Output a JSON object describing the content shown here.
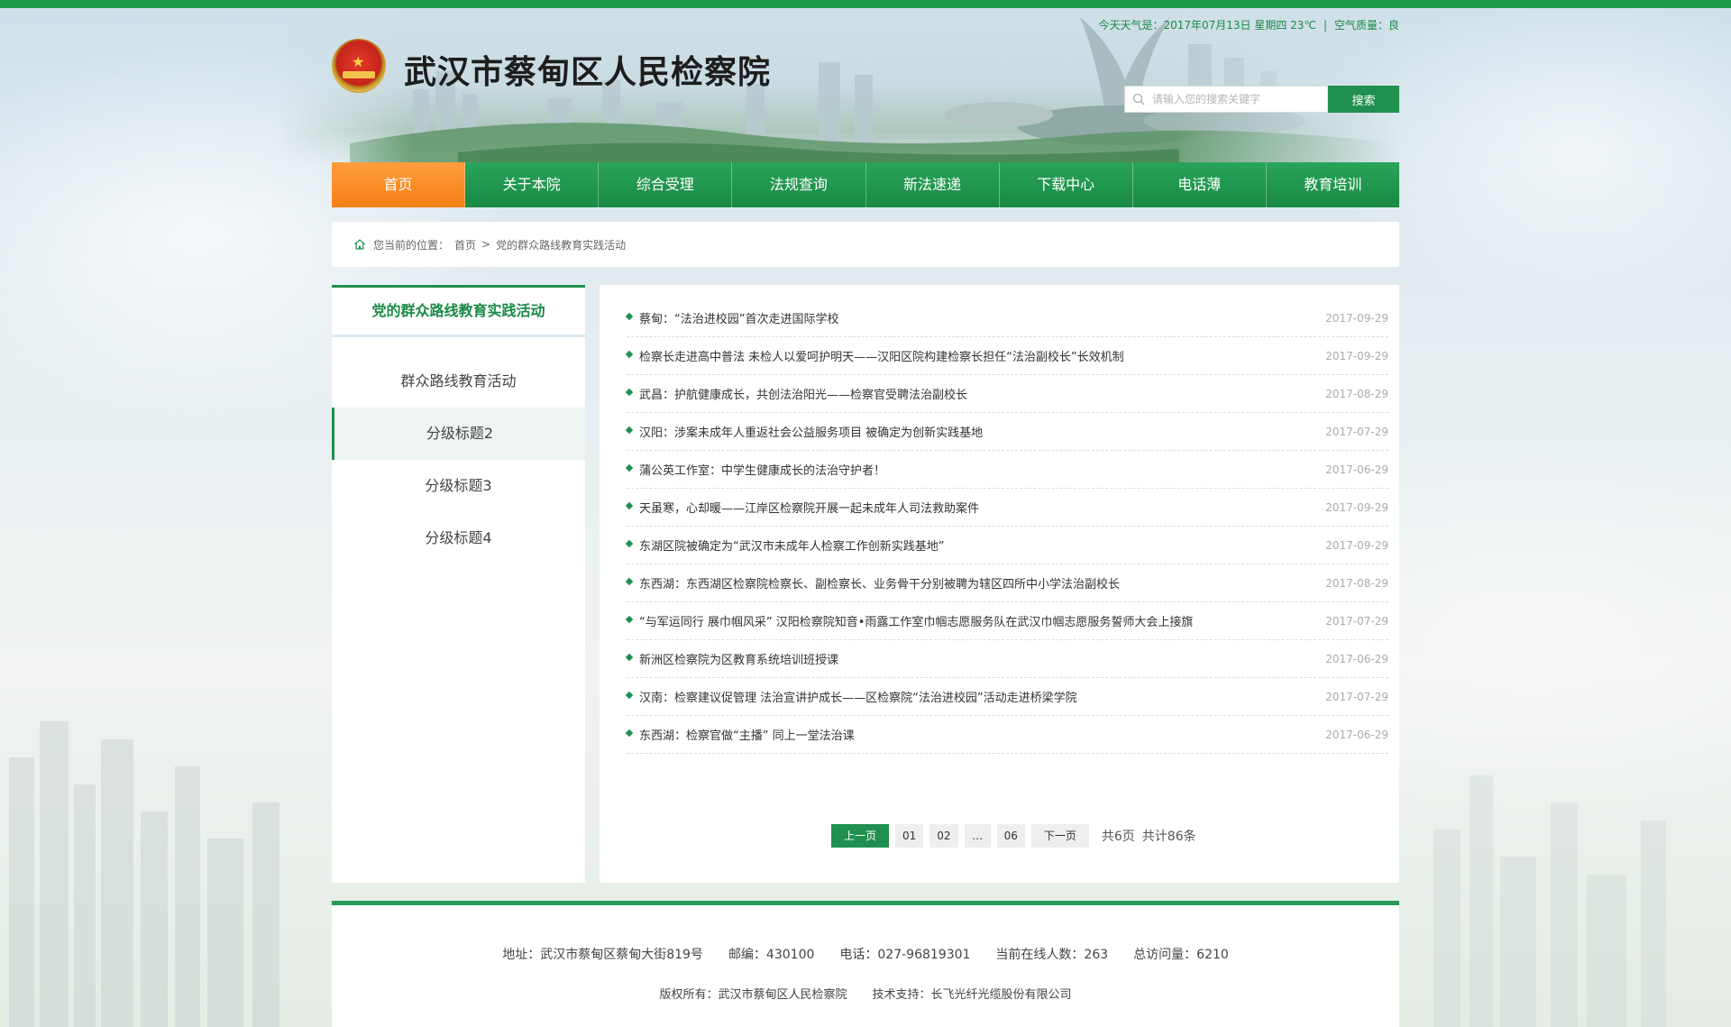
{
  "site": {
    "title": "武汉市蔡甸区人民检察院",
    "weather": "今天天气是：2017年07月13日 星期四 23℃",
    "air_quality": "空气质量：良"
  },
  "search": {
    "placeholder": "请输入您的搜索关键字",
    "button": "搜索"
  },
  "nav": [
    "首页",
    "关于本院",
    "综合受理",
    "法规查询",
    "新法速递",
    "下载中心",
    "电话薄",
    "教育培训"
  ],
  "breadcrumb": {
    "prefix": "您当前的位置：",
    "home": "首页",
    "separator": ">",
    "current": "党的群众路线教育实践活动"
  },
  "sidebar": {
    "heading": "党的群众路线教育实践活动",
    "items": [
      "群众路线教育活动",
      "分级标题2",
      "分级标题3",
      "分级标题4"
    ],
    "active_index": 1
  },
  "news": [
    {
      "title": "蔡甸：“法治进校园”首次走进国际学校",
      "date": "2017-09-29"
    },
    {
      "title": "检察长走进高中普法 未检人以爱呵护明天——汉阳区院构建检察长担任“法治副校长”长效机制",
      "date": "2017-09-29"
    },
    {
      "title": "武昌：护航健康成长，共创法治阳光——检察官受聘法治副校长",
      "date": "2017-08-29"
    },
    {
      "title": "汉阳：涉案未成年人重返社会公益服务项目 被确定为创新实践基地",
      "date": "2017-07-29"
    },
    {
      "title": "蒲公英工作室：中学生健康成长的法治守护者！",
      "date": "2017-06-29"
    },
    {
      "title": "天虽寒，心却暖——江岸区检察院开展一起未成年人司法救助案件",
      "date": "2017-09-29"
    },
    {
      "title": "东湖区院被确定为“武汉市未成年人检察工作创新实践基地”",
      "date": "2017-09-29"
    },
    {
      "title": "东西湖：东西湖区检察院检察长、副检察长、业务骨干分别被聘为辖区四所中小学法治副校长",
      "date": "2017-08-29"
    },
    {
      "title": "“与军运同行 展巾帼风采” 汉阳检察院知音•雨露工作室巾帼志愿服务队在武汉巾帼志愿服务誓师大会上接旗",
      "date": "2017-07-29"
    },
    {
      "title": "新洲区检察院为区教育系统培训班授课",
      "date": "2017-06-29"
    },
    {
      "title": "汉南：检察建议促管理 法治宣讲护成长——区检察院“法治进校园”活动走进桥梁学院",
      "date": "2017-07-29"
    },
    {
      "title": "东西湖：检察官做“主播” 同上一堂法治课",
      "date": "2017-06-29"
    }
  ],
  "pager": {
    "prev": "上一页",
    "pages": [
      "01",
      "02",
      "…",
      "06"
    ],
    "next": "下一页",
    "total_pages": "共6页",
    "total_items": "共计86条"
  },
  "footer": {
    "address": "地址：武汉市蔡甸区蔡甸大街819号",
    "postcode": "邮编：430100",
    "phone": "电话：027-96819301",
    "online": "当前在线人数：263",
    "visits": "总访问量：6210",
    "copyright": "版权所有：武汉市蔡甸区人民检察院",
    "tech": "技术支持：长飞光纤光缆股份有限公司"
  },
  "colors": {
    "brand_green": "#1f9050",
    "active_orange": "#f57f16"
  },
  "icons": [
    "search-icon",
    "home-icon",
    "emblem-icon"
  ]
}
